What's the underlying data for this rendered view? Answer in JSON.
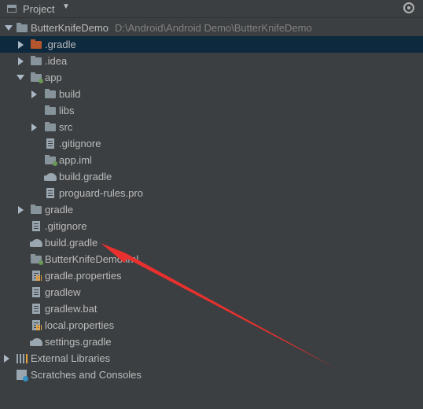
{
  "header": {
    "title": "Project"
  },
  "tree": {
    "root": {
      "label": "ButterKnifeDemo",
      "path": "D:\\Android\\Android Demo\\ButterKnifeDemo"
    },
    "gradle_dir": ".gradle",
    "idea_dir": ".idea",
    "app": {
      "label": "app",
      "build": "build",
      "libs": "libs",
      "src": "src",
      "gitignore": ".gitignore",
      "app_iml": "app.iml",
      "build_gradle": "build.gradle",
      "proguard": "proguard-rules.pro"
    },
    "gradle": "gradle",
    "gitignore": ".gitignore",
    "build_gradle": "build.gradle",
    "project_iml": "ButterKnifeDemo.iml",
    "gradle_properties": "gradle.properties",
    "gradlew": "gradlew",
    "gradlew_bat": "gradlew.bat",
    "local_properties": "local.properties",
    "settings_gradle": "settings.gradle",
    "external_libraries": "External Libraries",
    "scratches": "Scratches and Consoles"
  },
  "colors": {
    "background": "#3c3f41",
    "selection": "#0d293e",
    "annotation": "#e8312f"
  }
}
